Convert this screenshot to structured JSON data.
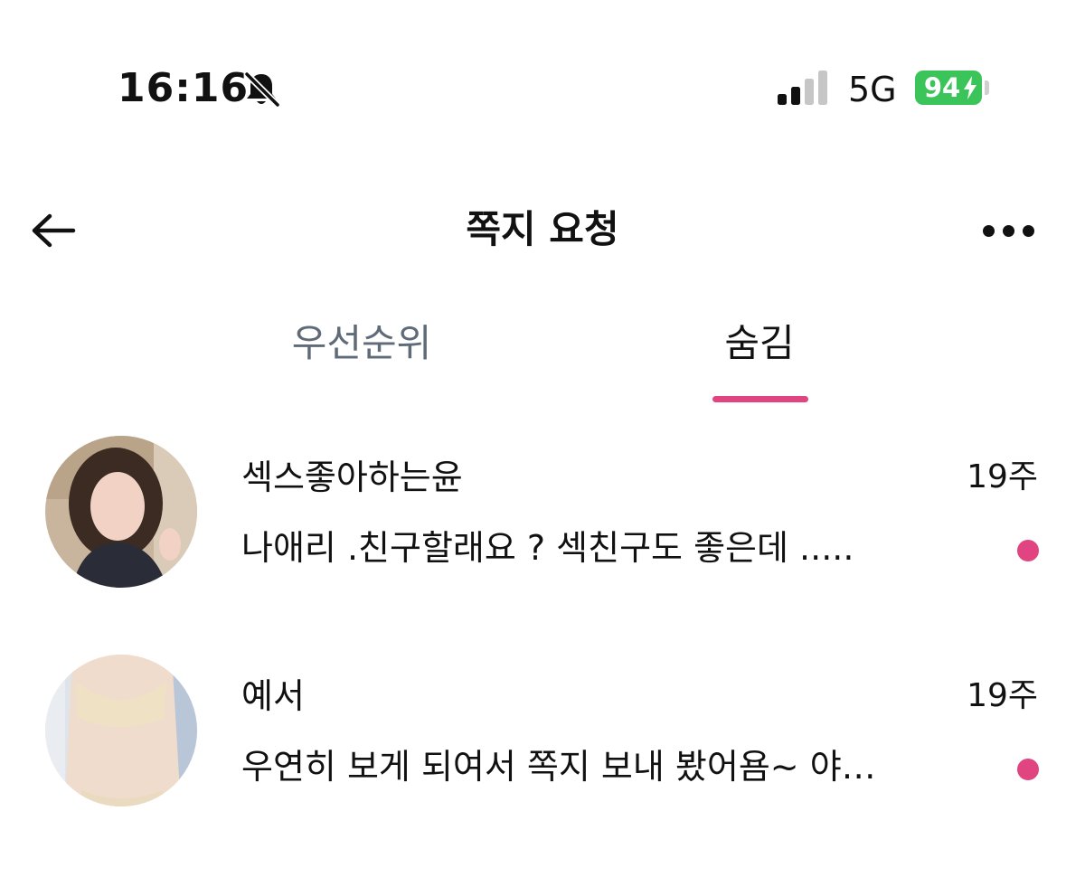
{
  "status_bar": {
    "time": "16:16",
    "bell_icon": "bell-slash-icon",
    "signal_icon": "cellular-signal-icon",
    "network": "5G",
    "battery": "94",
    "battery_color": "#3bc45a"
  },
  "header": {
    "back_icon": "arrow-left-icon",
    "title": "쪽지 요청",
    "more_icon": "ellipsis-icon"
  },
  "tabs": [
    {
      "label": "우선순위",
      "active": false
    },
    {
      "label": "숨김",
      "active": true
    }
  ],
  "colors": {
    "accent": "#e04581",
    "inactive_tab": "#5f6b78"
  },
  "messages": [
    {
      "name": "섹스좋아하는윤",
      "time": "19주",
      "preview": "나애리 .친구할래요 ? 섹친구도 좋은데 .....",
      "unread": true
    },
    {
      "name": "예서",
      "time": "19주",
      "preview": "우연히 보게 되여서 쪽지 보내 봤어욤~ 야…",
      "unread": true
    }
  ]
}
